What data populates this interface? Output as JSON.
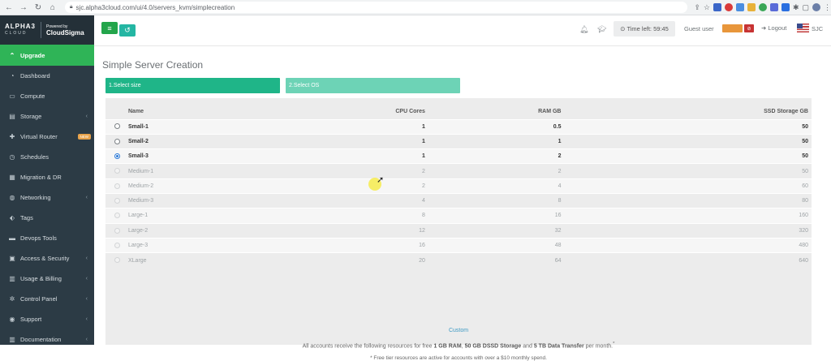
{
  "browser": {
    "url": "sjc.alpha3cloud.com/ui/4.0/servers_kvm/simplecreation",
    "back_icon": "arrow-left-icon",
    "forward_icon": "arrow-right-icon",
    "reload_icon": "reload-icon"
  },
  "brand": {
    "name": "ALPHA3",
    "sub": "CLOUD",
    "powered_by": "Powered by",
    "partner": "CloudSigma"
  },
  "sidebar": {
    "items": [
      {
        "label": "Upgrade",
        "icon": "chevron-up-icon",
        "active": true,
        "has_chevron": false
      },
      {
        "label": "Dashboard",
        "icon": "dashboard-icon",
        "has_chevron": false
      },
      {
        "label": "Compute",
        "icon": "monitor-icon",
        "has_chevron": false
      },
      {
        "label": "Storage",
        "icon": "storage-icon",
        "has_chevron": true
      },
      {
        "label": "Virtual Router",
        "icon": "router-icon",
        "has_chevron": false,
        "badge": "NEW"
      },
      {
        "label": "Schedules",
        "icon": "clock-icon",
        "has_chevron": false
      },
      {
        "label": "Migration & DR",
        "icon": "migration-icon",
        "has_chevron": false
      },
      {
        "label": "Networking",
        "icon": "globe-icon",
        "has_chevron": true
      },
      {
        "label": "Tags",
        "icon": "tag-icon",
        "has_chevron": false
      },
      {
        "label": "Devops Tools",
        "icon": "toolbox-icon",
        "has_chevron": false
      },
      {
        "label": "Access & Security",
        "icon": "lock-icon",
        "has_chevron": true
      },
      {
        "label": "Usage & Billing",
        "icon": "bar-chart-icon",
        "has_chevron": true
      },
      {
        "label": "Control Panel",
        "icon": "gears-icon",
        "has_chevron": true
      },
      {
        "label": "Support",
        "icon": "support-icon",
        "has_chevron": true
      },
      {
        "label": "Documentation",
        "icon": "bank-icon",
        "has_chevron": true
      }
    ]
  },
  "header": {
    "time_left": "Time left: 59:45",
    "guest_user": "Guest user",
    "logout": "Logout",
    "region": "SJC"
  },
  "page": {
    "title": "Simple Server Creation",
    "step1": "1.Select size",
    "step2": "2.Select OS"
  },
  "table": {
    "columns": [
      "Name",
      "CPU Cores",
      "RAM GB",
      "SSD Storage GB"
    ],
    "rows": [
      {
        "name": "Small-1",
        "cpu": "1",
        "ram": "0.5",
        "ssd": "50",
        "state": "available",
        "selected": false
      },
      {
        "name": "Small-2",
        "cpu": "1",
        "ram": "1",
        "ssd": "50",
        "state": "available",
        "selected": false
      },
      {
        "name": "Small-3",
        "cpu": "1",
        "ram": "2",
        "ssd": "50",
        "state": "available",
        "selected": true
      },
      {
        "name": "Medium-1",
        "cpu": "2",
        "ram": "2",
        "ssd": "50",
        "state": "disabled",
        "selected": false
      },
      {
        "name": "Medium-2",
        "cpu": "2",
        "ram": "4",
        "ssd": "60",
        "state": "disabled",
        "selected": false
      },
      {
        "name": "Medium-3",
        "cpu": "4",
        "ram": "8",
        "ssd": "80",
        "state": "disabled",
        "selected": false
      },
      {
        "name": "Large-1",
        "cpu": "8",
        "ram": "16",
        "ssd": "160",
        "state": "disabled",
        "selected": false
      },
      {
        "name": "Large-2",
        "cpu": "12",
        "ram": "32",
        "ssd": "320",
        "state": "disabled",
        "selected": false
      },
      {
        "name": "Large-3",
        "cpu": "16",
        "ram": "48",
        "ssd": "480",
        "state": "disabled",
        "selected": false
      },
      {
        "name": "XLarge",
        "cpu": "20",
        "ram": "64",
        "ssd": "640",
        "state": "disabled",
        "selected": false
      }
    ]
  },
  "footer": {
    "custom": "Custom",
    "free_prefix": "All accounts receive the following resources for free",
    "free_ram": "1 GB RAM",
    "free_storage": "50 GB DSSD Storage",
    "free_and": "and",
    "free_transfer": "5 TB Data Transfer",
    "free_suffix": "per month.",
    "tier_note": "* Free tier resources are active for accounts with over a $10 monthly spend."
  },
  "colors": {
    "sidebar_bg": "#2c3b45",
    "active_green": "#2fb457",
    "step_active": "#1fb588",
    "step_inactive": "#6dd3b6",
    "link_blue": "#3f9bc4"
  }
}
